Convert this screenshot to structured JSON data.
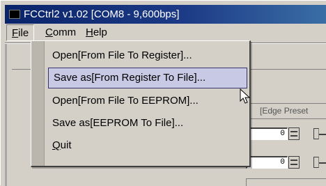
{
  "window": {
    "title": "FCCtrl2 v1.02  [COM8 - 9,600bps]"
  },
  "menubar": {
    "file": {
      "accel": "F",
      "rest": "ile"
    },
    "comm": {
      "accel": "C",
      "rest": "omm"
    },
    "help": {
      "accel": "H",
      "rest": "elp"
    }
  },
  "file_menu": {
    "items": [
      {
        "label": "Open[From File To Register]..."
      },
      {
        "label": "Save as[From Register To File]..."
      },
      {
        "label": "Open[From File To EEPROM]..."
      },
      {
        "label": "Save as[EEPROM To File]..."
      },
      {
        "label_accel": "Q",
        "label_rest": "uit"
      }
    ],
    "hovered_index": 1
  },
  "background": {
    "preset_box_text": "[Edge Preset",
    "field_1_value": "0",
    "field_2_value": "0"
  },
  "colors": {
    "titlebar_start": "#0a246a",
    "titlebar_end": "#3a6ea5",
    "face": "#d4d0c8",
    "hover_fill": "#c8c9e4",
    "hover_border": "#33336e"
  }
}
